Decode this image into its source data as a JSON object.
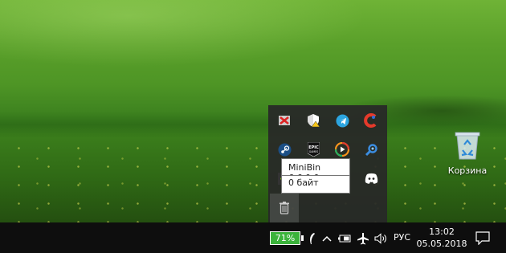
{
  "desktop": {
    "recycle_bin_label": "Корзина"
  },
  "tray_popup": {
    "icons": [
      {
        "name": "app-x-icon"
      },
      {
        "name": "security-shield-icon"
      },
      {
        "name": "telegram-icon"
      },
      {
        "name": "ccleaner-icon"
      },
      {
        "name": "steam-icon"
      },
      {
        "name": "epic-games-icon",
        "text": "EPIC\nGAMES"
      },
      {
        "name": "media-player-icon"
      },
      {
        "name": "blue-app-icon"
      },
      {
        "name": "nvidia-icon"
      },
      {
        "name": "discord-icon"
      },
      {
        "name": "minibin-trash-icon"
      }
    ],
    "tooltip": {
      "title": "MiniBin 6.6.0.0",
      "size": "0 байт"
    }
  },
  "taskbar": {
    "battery_percent": "71%",
    "language": "РУС",
    "time": "13:02",
    "date": "05.05.2018"
  },
  "colors": {
    "taskbar_bg": "#0e0e0e",
    "popup_bg": "#282828",
    "battery_green": "#3bb33b"
  }
}
